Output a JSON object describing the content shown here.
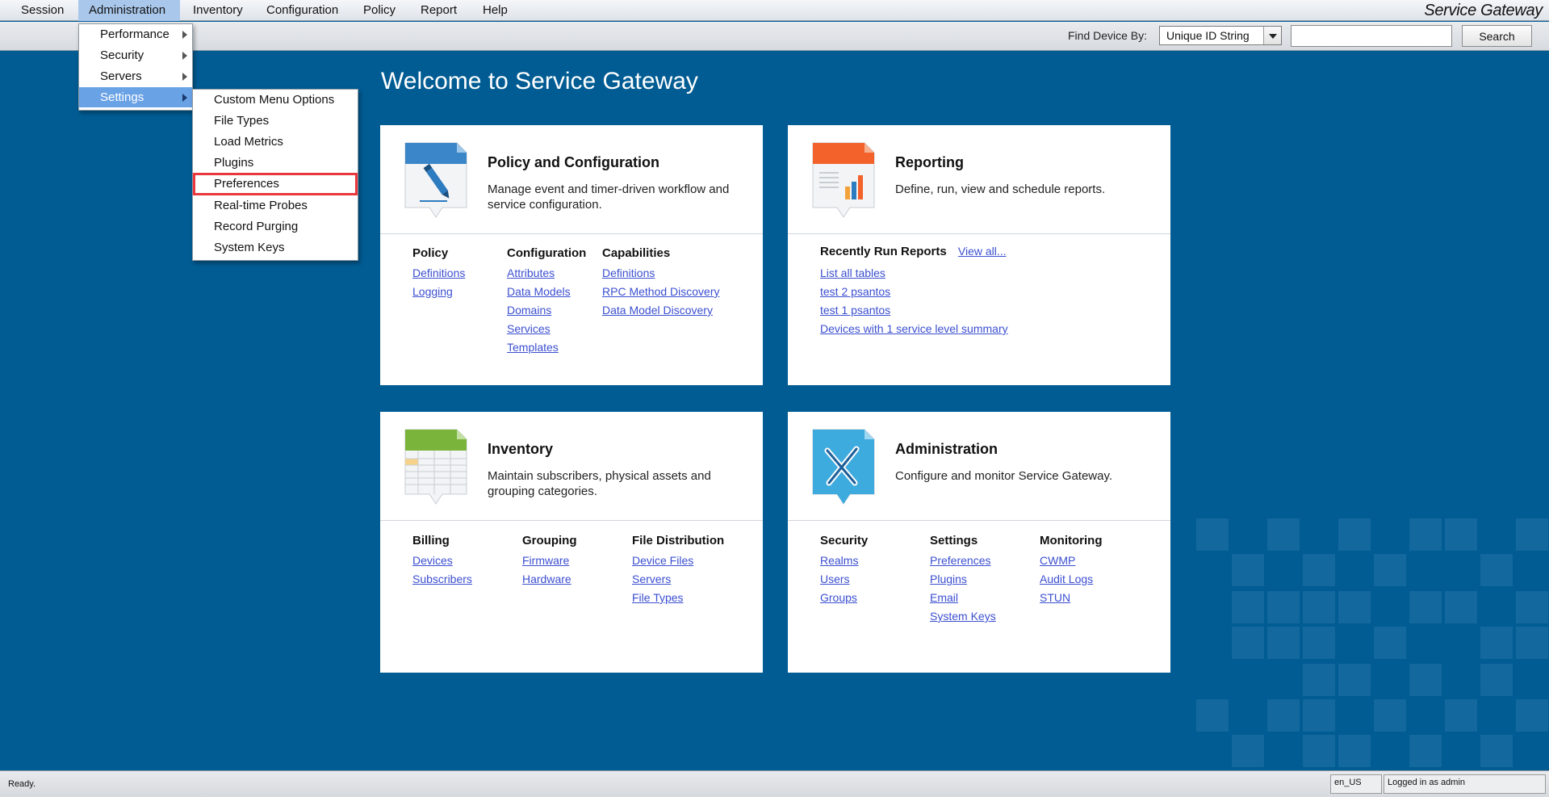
{
  "menubar": {
    "items": [
      "Session",
      "Administration",
      "Inventory",
      "Configuration",
      "Policy",
      "Report",
      "Help"
    ],
    "brand": "Service Gateway"
  },
  "toolbar": {
    "find_label": "Find Device By:",
    "find_select_value": "Unique ID String",
    "search_value": "",
    "search_button": "Search"
  },
  "admin_menu": {
    "items": [
      "Performance",
      "Security",
      "Servers",
      "Settings"
    ],
    "active": "Settings"
  },
  "settings_menu": {
    "items": [
      "Custom Menu Options",
      "File Types",
      "Load Metrics",
      "Plugins",
      "Preferences",
      "Real-time Probes",
      "Record Purging",
      "System Keys"
    ],
    "highlighted": "Preferences"
  },
  "main": {
    "welcome": "Welcome to Service Gateway",
    "cards": {
      "policy": {
        "title": "Policy and Configuration",
        "desc": "Manage event and timer-driven workflow and service configuration.",
        "icon": "pencil-document-icon",
        "accent": "#3a86c8",
        "cols": [
          {
            "title": "Policy",
            "links": [
              "Definitions",
              "Logging"
            ]
          },
          {
            "title": "Configuration",
            "links": [
              "Attributes",
              "Data Models",
              "Domains",
              "Services",
              "Templates"
            ]
          },
          {
            "title": "Capabilities",
            "links": [
              "Definitions",
              "RPC Method Discovery",
              "Data Model Discovery"
            ]
          }
        ]
      },
      "reporting": {
        "title": "Reporting",
        "desc": "Define, run, view and schedule reports.",
        "icon": "report-chart-icon",
        "accent": "#f2622a",
        "recent_title": "Recently Run Reports",
        "view_all": "View all...",
        "links": [
          "List all tables",
          "test 2 psantos",
          "test 1 psantos",
          "Devices with 1 service level summary"
        ]
      },
      "inventory": {
        "title": "Inventory",
        "desc": "Maintain subscribers, physical assets and grouping categories.",
        "icon": "spreadsheet-icon",
        "accent": "#7ab43a",
        "cols": [
          {
            "title": "Billing",
            "links": [
              "Devices",
              "Subscribers"
            ]
          },
          {
            "title": "Grouping",
            "links": [
              "Firmware",
              "Hardware"
            ]
          },
          {
            "title": "File Distribution",
            "links": [
              "Device Files",
              "Servers",
              "File Types"
            ]
          }
        ]
      },
      "administration": {
        "title": "Administration",
        "desc": "Configure and monitor Service Gateway.",
        "icon": "wrench-screwdriver-icon",
        "accent": "#2aa3dc",
        "cols": [
          {
            "title": "Security",
            "links": [
              "Realms",
              "Users",
              "Groups"
            ]
          },
          {
            "title": "Settings",
            "links": [
              "Preferences",
              "Plugins",
              "Email",
              "System Keys"
            ]
          },
          {
            "title": "Monitoring",
            "links": [
              "CWMP",
              "Audit Logs",
              "STUN"
            ]
          }
        ]
      }
    }
  },
  "status": {
    "text": "Ready.",
    "locale": "en_US",
    "login": "Logged in as admin"
  }
}
